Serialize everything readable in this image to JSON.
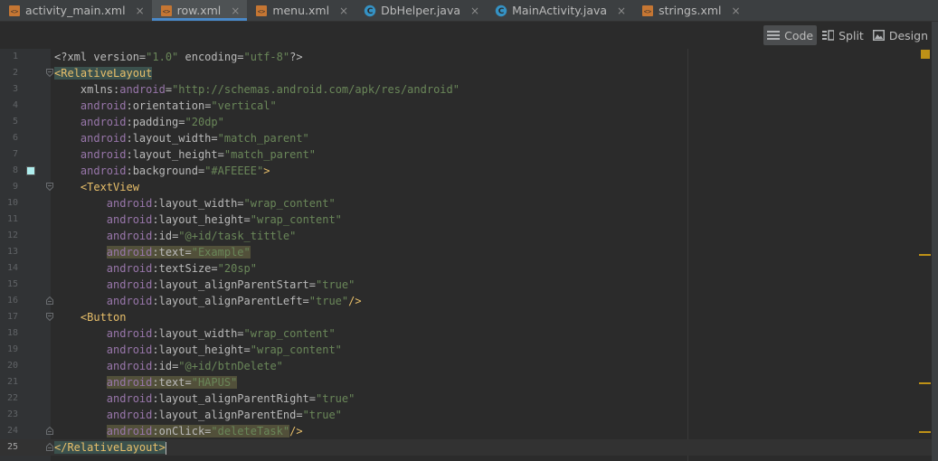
{
  "tabs": [
    {
      "name": "activity_main.xml",
      "type": "xml",
      "active": false
    },
    {
      "name": "row.xml",
      "type": "xml",
      "active": true
    },
    {
      "name": "menu.xml",
      "type": "xml",
      "active": false
    },
    {
      "name": "DbHelper.java",
      "type": "java",
      "active": false
    },
    {
      "name": "MainActivity.java",
      "type": "java",
      "active": false
    },
    {
      "name": "strings.xml",
      "type": "xml",
      "active": false
    }
  ],
  "view_modes": {
    "code": "Code",
    "split": "Split",
    "design": "Design",
    "selected": "Code"
  },
  "colors": {
    "accent": "#4a88c7",
    "tag": "#e8bf6a",
    "namespace": "#9876aa",
    "value": "#6a8759",
    "swatch": "#afeeee"
  },
  "current_line": 25,
  "lines": [
    {
      "n": "1",
      "text": "<?xml version=\"1.0\" encoding=\"utf-8\"?>"
    },
    {
      "n": "2",
      "text": "<RelativeLayout"
    },
    {
      "n": "3",
      "text": "    xmlns:android=\"http://schemas.android.com/apk/res/android\""
    },
    {
      "n": "4",
      "text": "    android:orientation=\"vertical\""
    },
    {
      "n": "5",
      "text": "    android:padding=\"20dp\""
    },
    {
      "n": "6",
      "text": "    android:layout_width=\"match_parent\""
    },
    {
      "n": "7",
      "text": "    android:layout_height=\"match_parent\""
    },
    {
      "n": "8",
      "text": "    android:background=\"#AFEEEE\">"
    },
    {
      "n": "9",
      "text": "    <TextView"
    },
    {
      "n": "10",
      "text": "        android:layout_width=\"wrap_content\""
    },
    {
      "n": "11",
      "text": "        android:layout_height=\"wrap_content\""
    },
    {
      "n": "12",
      "text": "        android:id=\"@+id/task_tittle\""
    },
    {
      "n": "13",
      "text": "        android:text=\"Example\""
    },
    {
      "n": "14",
      "text": "        android:textSize=\"20sp\""
    },
    {
      "n": "15",
      "text": "        android:layout_alignParentStart=\"true\""
    },
    {
      "n": "16",
      "text": "        android:layout_alignParentLeft=\"true\"/>"
    },
    {
      "n": "17",
      "text": "    <Button"
    },
    {
      "n": "18",
      "text": "        android:layout_width=\"wrap_content\""
    },
    {
      "n": "19",
      "text": "        android:layout_height=\"wrap_content\""
    },
    {
      "n": "20",
      "text": "        android:id=\"@+id/btnDelete\""
    },
    {
      "n": "21",
      "text": "        android:text=\"HAPUS\""
    },
    {
      "n": "22",
      "text": "        android:layout_alignParentRight=\"true\""
    },
    {
      "n": "23",
      "text": "        android:layout_alignParentEnd=\"true\""
    },
    {
      "n": "24",
      "text": "        android:onClick=\"deleteTask\"/>"
    },
    {
      "n": "25",
      "text": "</RelativeLayout>"
    }
  ]
}
